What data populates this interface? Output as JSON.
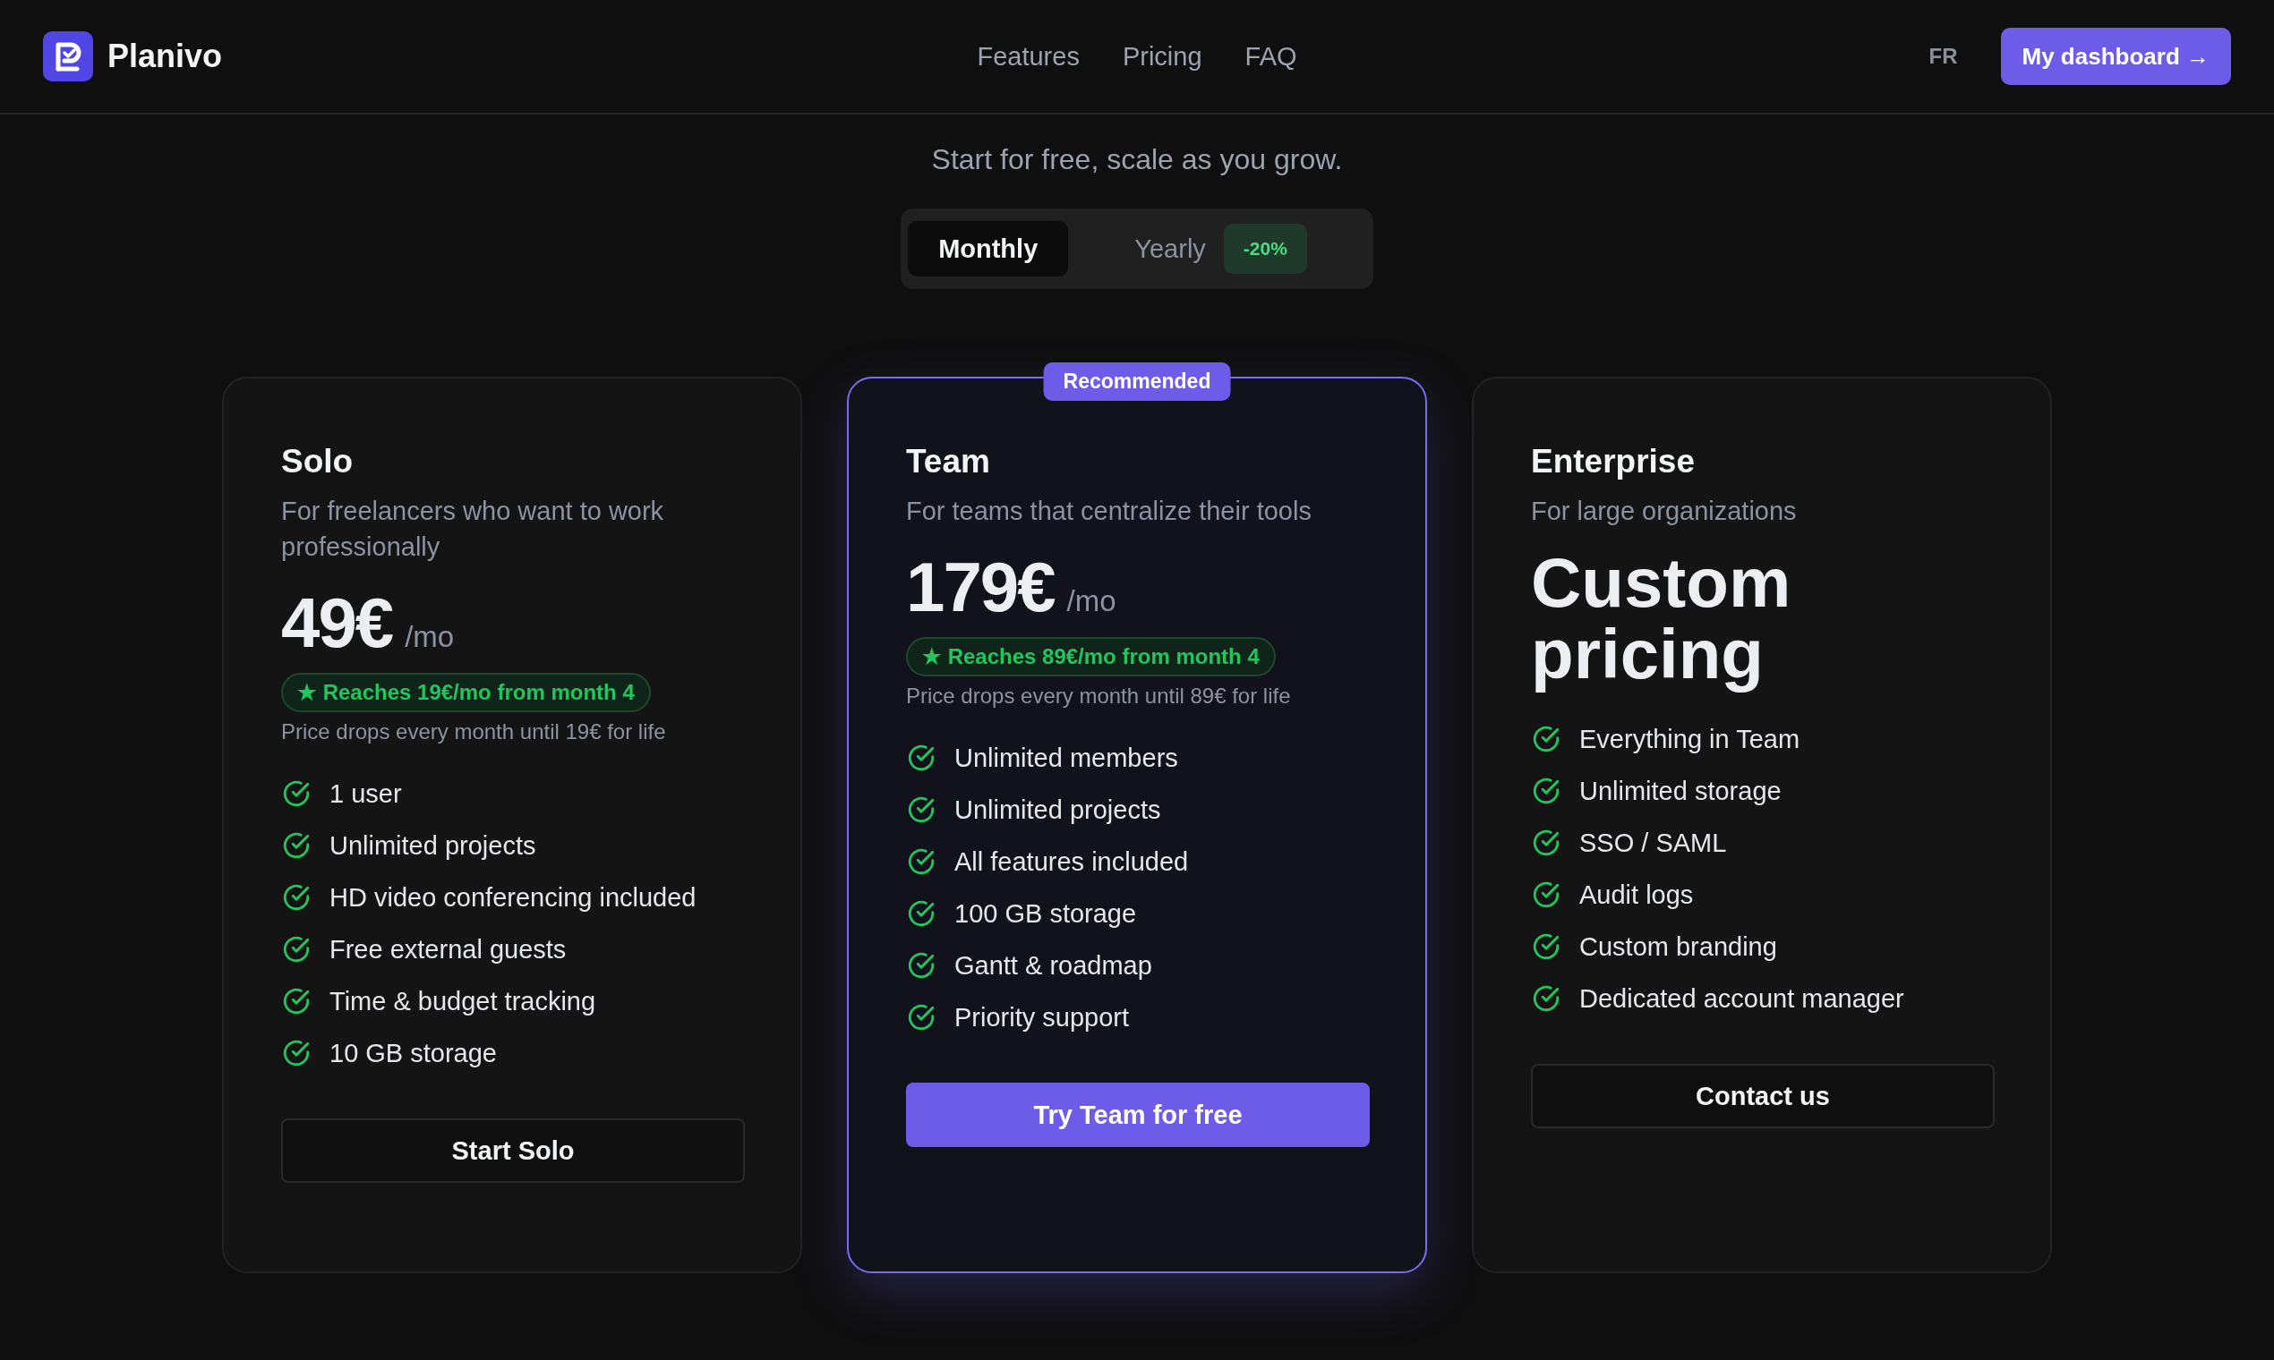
{
  "header": {
    "brand": "Planivo",
    "nav": [
      "Features",
      "Pricing",
      "FAQ"
    ],
    "language": "FR",
    "dashboard_button": "My dashboard →"
  },
  "subtitle": "Start for free, scale as you grow.",
  "billing_toggle": [
    {
      "label": "Monthly",
      "selected": true
    },
    {
      "label": "Yearly",
      "selected": false,
      "badge": "-20%"
    }
  ],
  "plans": [
    {
      "name": "Solo",
      "description": "For freelancers who want to work professionally",
      "kind": "fixed",
      "price": "49€",
      "period": "/mo",
      "promo": "★ Reaches 19€/mo from month 4",
      "note": "Price drops every month until 19€ for life",
      "recommended": false,
      "features": [
        "1 user",
        "Unlimited projects",
        "HD video conferencing included",
        "Free external guests",
        "Time & budget tracking",
        "10 GB storage"
      ],
      "button": "Start Solo"
    },
    {
      "name": "Team",
      "badge": "Recommended",
      "description": "For teams that centralize their tools",
      "kind": "fixed",
      "price": "179€",
      "period": "/mo",
      "promo": "★ Reaches 89€/mo from month 4",
      "note": "Price drops every month until 89€ for life",
      "recommended": true,
      "features": [
        "Unlimited members",
        "Unlimited projects",
        "All features included",
        "100 GB storage",
        "Gantt & roadmap",
        "Priority support"
      ],
      "button": "Try Team for free"
    },
    {
      "name": "Enterprise",
      "description": "For large organizations",
      "kind": "custom",
      "price": "Custom pricing",
      "recommended": false,
      "features": [
        "Everything in Team",
        "Unlimited storage",
        "SSO / SAML",
        "Audit logs",
        "Custom branding",
        "Dedicated account manager"
      ],
      "button": "Contact us"
    }
  ]
}
